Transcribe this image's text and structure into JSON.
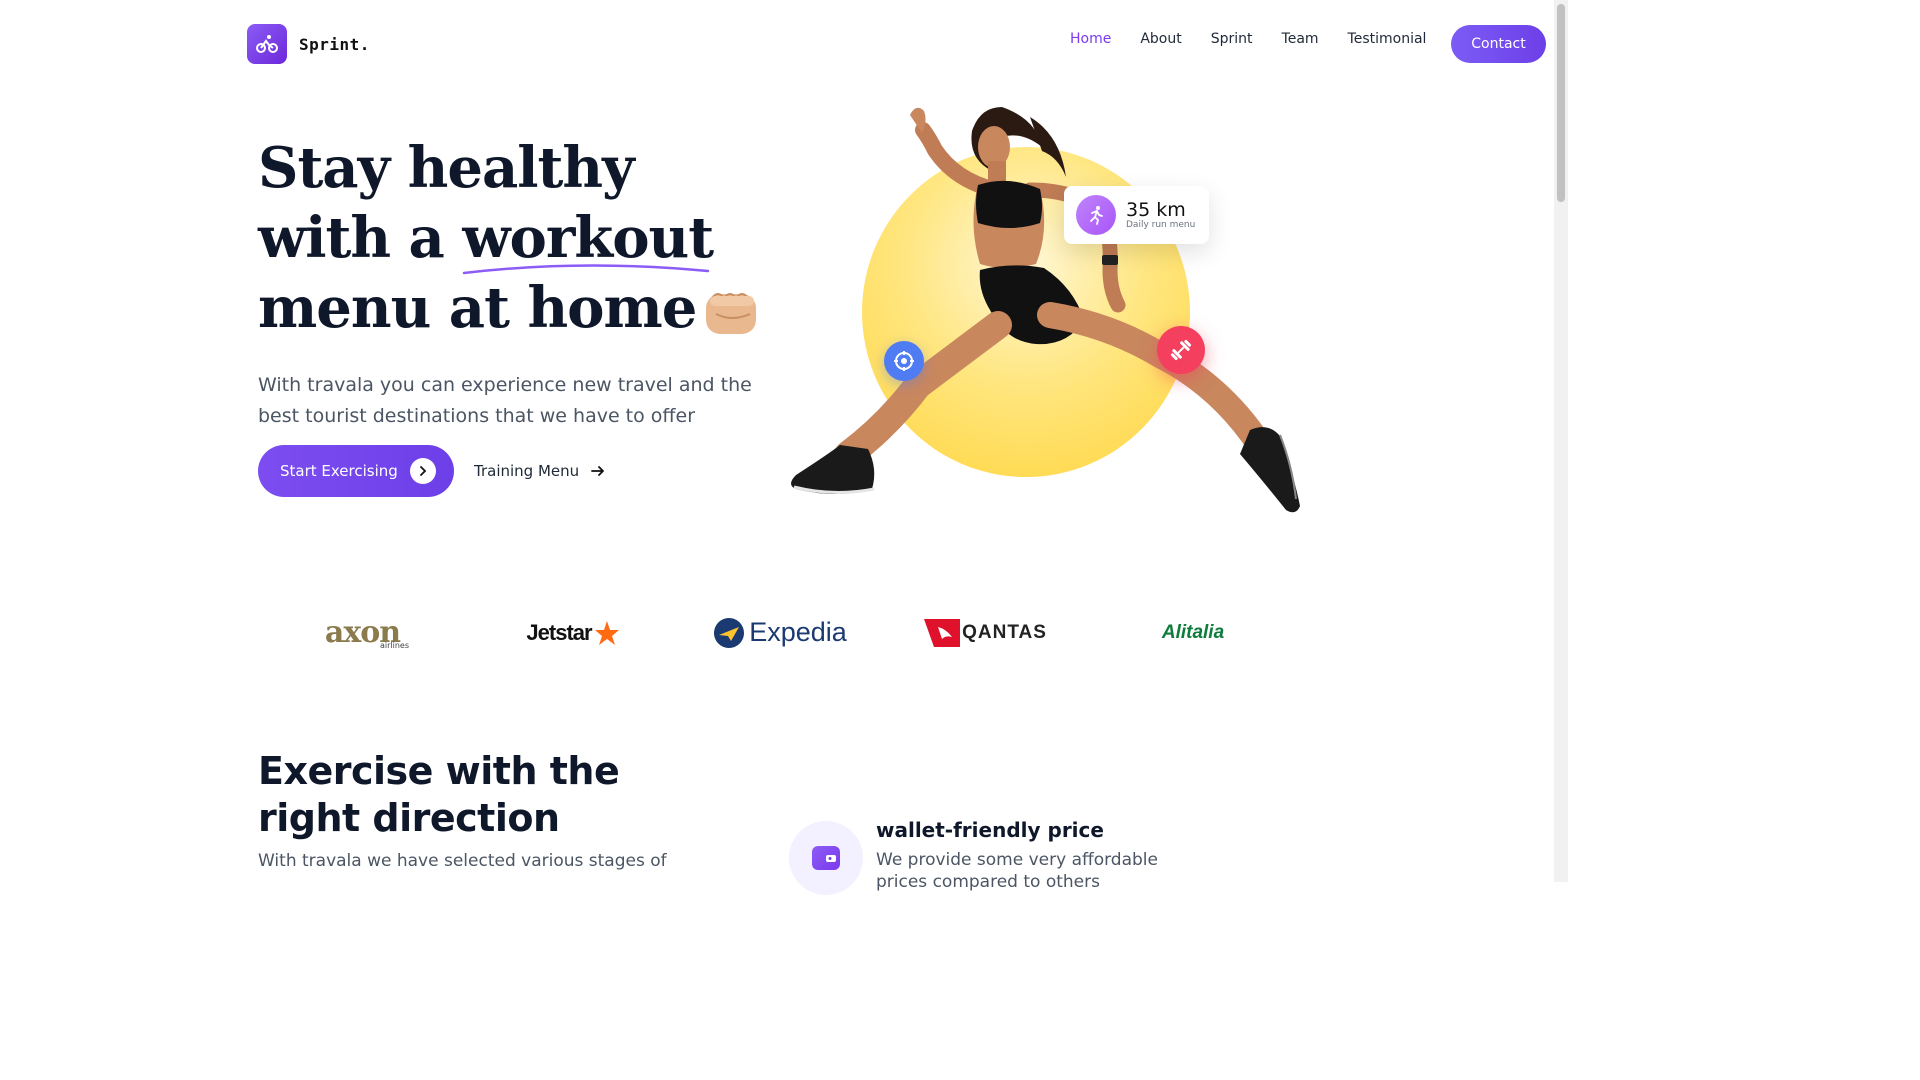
{
  "header": {
    "brand": "Sprint.",
    "nav": [
      "Home",
      "About",
      "Sprint",
      "Team",
      "Testimonial"
    ],
    "active_nav": "Home",
    "contact_label": "Contact"
  },
  "hero": {
    "title_line1": "Stay healthy",
    "title_line2_a": "with a ",
    "title_line2_b": "workout",
    "title_line3": "menu at home",
    "subtitle": "With travala you can experience new travel and the best tourist destinations that we have to offer",
    "primary_cta": "Start Exercising",
    "secondary_cta": "Training Menu",
    "stat_card": {
      "value": "35 km",
      "label": "Daily run menu"
    }
  },
  "brands": {
    "axon": "axon",
    "axon_sub": "airlines",
    "jetstar": "Jetstar",
    "expedia": "Expedia",
    "qantas": "QANTAS",
    "alitalia": "Alitalia"
  },
  "section_direction": {
    "title_line1": "Exercise with the",
    "title_line2": "right direction",
    "subtitle": "With travala we have selected various stages of",
    "feature": {
      "title": "wallet-friendly price",
      "description": "We provide some very affordable prices compared to others"
    }
  },
  "colors": {
    "accent": "#7c3aed",
    "sun": "#ffd43b",
    "badge_blue": "#4f7cf3",
    "badge_red": "#f43f5e"
  }
}
